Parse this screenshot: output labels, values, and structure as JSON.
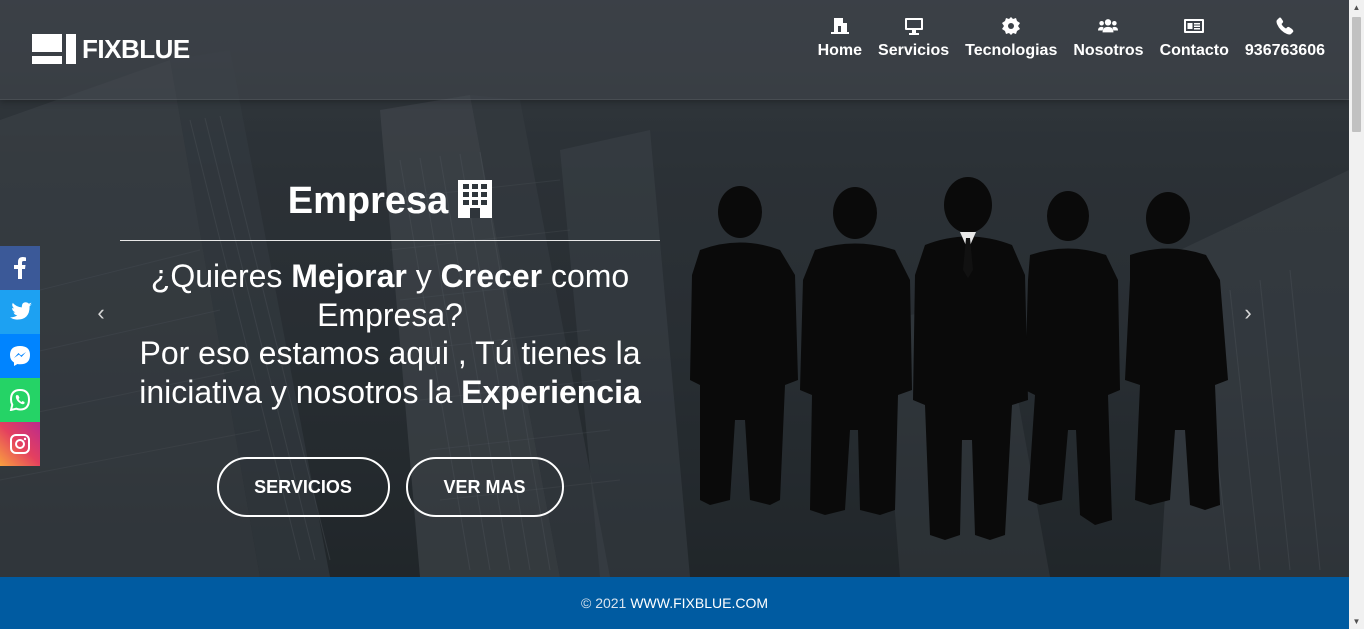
{
  "brand": {
    "name": "FIXBLUE"
  },
  "nav": [
    {
      "label": "Home",
      "icon": "building-door-icon"
    },
    {
      "label": "Servicios",
      "icon": "monitor-icon"
    },
    {
      "label": "Tecnologias",
      "icon": "gear-icon"
    },
    {
      "label": "Nosotros",
      "icon": "users-icon"
    },
    {
      "label": "Contacto",
      "icon": "contact-card-icon"
    },
    {
      "label": "936763606",
      "icon": "phone-icon"
    }
  ],
  "hero": {
    "title": "Empresa",
    "title_icon": "building-icon",
    "lead": {
      "l1_pre": "¿Quieres ",
      "l1_b1": "Mejorar",
      "l1_mid": " y ",
      "l1_b2": "Crecer",
      "l1_post": " como",
      "l2": "Empresa?",
      "l3": "Por eso estamos aqui , Tú tienes la",
      "l4_pre": "iniciativa y nosotros la ",
      "l4_b": "Experiencia"
    },
    "buttons": {
      "primary": "SERVICIOS",
      "secondary": "VER MAS"
    },
    "prev_arrow": "‹",
    "next_arrow": "›"
  },
  "social": [
    {
      "name": "facebook",
      "icon": "facebook-icon",
      "color": "#3b5998"
    },
    {
      "name": "twitter",
      "icon": "twitter-icon",
      "color": "#1da1f2"
    },
    {
      "name": "messenger",
      "icon": "messenger-icon",
      "color": "#0084ff"
    },
    {
      "name": "whatsapp",
      "icon": "whatsapp-icon",
      "color": "#25d366"
    },
    {
      "name": "instagram",
      "icon": "instagram-icon",
      "color": "#e4405f"
    }
  ],
  "footer": {
    "copyright": "© 2021",
    "site": "WWW.FIXBLUE.COM"
  },
  "colors": {
    "footer_bg": "#005ba1",
    "hero_overlay": "#2f353b"
  }
}
